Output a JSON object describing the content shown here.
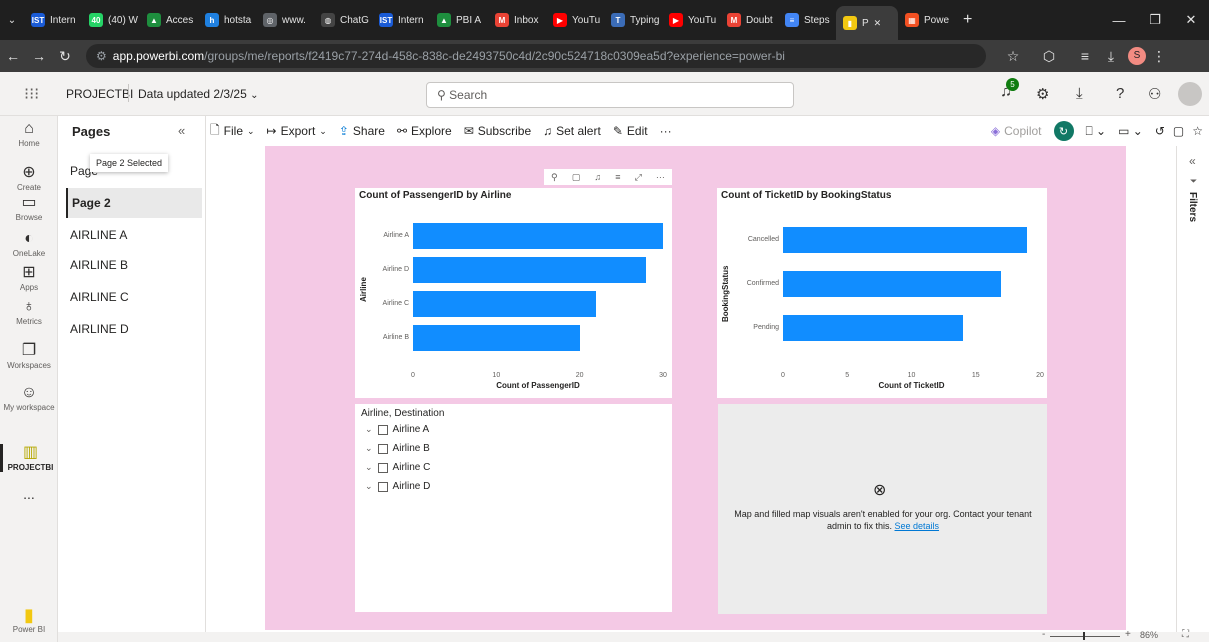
{
  "browser": {
    "tabs": [
      {
        "label": "Intern",
        "fav": "IST",
        "color": "#1a5bd6"
      },
      {
        "label": "(40) W",
        "fav": "40",
        "color": "#25d366"
      },
      {
        "label": "Acces",
        "fav": "▲",
        "color": "#1e8e3e"
      },
      {
        "label": "hotsta",
        "fav": "h",
        "color": "#1f80e0"
      },
      {
        "label": "www.",
        "fav": "◎",
        "color": "#5f6368"
      },
      {
        "label": "ChatG",
        "fav": "◍",
        "color": "#444"
      },
      {
        "label": "Intern",
        "fav": "IST",
        "color": "#1a5bd6"
      },
      {
        "label": "PBI A",
        "fav": "▲",
        "color": "#1e8e3e"
      },
      {
        "label": "Inbox",
        "fav": "M",
        "color": "#ea4335"
      },
      {
        "label": "YouTu",
        "fav": "▶",
        "color": "#ff0000"
      },
      {
        "label": "Typing",
        "fav": "T",
        "color": "#3b6cb7"
      },
      {
        "label": "YouTu",
        "fav": "▶",
        "color": "#ff0000"
      },
      {
        "label": "Doubt",
        "fav": "M",
        "color": "#ea4335"
      },
      {
        "label": "Steps",
        "fav": "≡",
        "color": "#4285f4"
      },
      {
        "label": "P",
        "fav": "▮",
        "color": "#f2c811"
      },
      {
        "label": "Powe",
        "fav": "▦",
        "color": "#f25022"
      }
    ],
    "new_tab": "+",
    "url_host": "app.powerbi.com",
    "url_path": "/groups/me/reports/f2419c77-274d-458c-838c-de2493750c4d/2c90c524718c0309ea5d?experience=power-bi",
    "profile_initial": "S"
  },
  "header": {
    "workspace": "PROJECTBI",
    "data_updated": "Data updated 2/3/25",
    "search_placeholder": "Search",
    "notif_count": "5"
  },
  "rail": [
    {
      "label": "Home",
      "icon": "⌂"
    },
    {
      "label": "Create",
      "icon": "⊕"
    },
    {
      "label": "Browse",
      "icon": "▭"
    },
    {
      "label": "OneLake",
      "icon": "◐"
    },
    {
      "label": "Apps",
      "icon": "⊞"
    },
    {
      "label": "Metrics",
      "icon": "♁"
    },
    {
      "label": "Workspaces",
      "icon": "❐"
    },
    {
      "label": "My workspace",
      "icon": "☺"
    },
    {
      "label": "PROJECTBI",
      "icon": "▥"
    },
    {
      "label": "...",
      "icon": ""
    }
  ],
  "rail_brand": "Power BI",
  "pages_pane": {
    "title": "Pages",
    "collapse": "«",
    "tooltip": "Page 2 Selected",
    "items": [
      "Page",
      "Page 2",
      "AIRLINE A",
      "AIRLINE B",
      "AIRLINE C",
      "AIRLINE D"
    ]
  },
  "toolbar": {
    "file": "File",
    "export": "Export",
    "share": "Share",
    "explore": "Explore",
    "subscribe": "Subscribe",
    "set_alert": "Set alert",
    "edit": "Edit",
    "more": "···",
    "copilot": "Copilot"
  },
  "filters_label": "Filters",
  "charts": [
    {
      "type": "bar",
      "title": "Count of PassengerID by Airline",
      "categories": [
        "Airline A",
        "Airline D",
        "Airline C",
        "Airline B"
      ],
      "values": [
        30,
        28,
        22,
        20
      ],
      "xlabel": "Count of PassengerID",
      "ylabel": "Airline",
      "xlim": [
        0,
        30
      ],
      "ticks": [
        0,
        10,
        20,
        30
      ]
    },
    {
      "type": "bar",
      "title": "Count of TicketID by BookingStatus",
      "categories": [
        "Cancelled",
        "Confirmed",
        "Pending"
      ],
      "values": [
        19,
        17,
        14
      ],
      "xlabel": "Count of TicketID",
      "ylabel": "BookingStatus",
      "xlim": [
        0,
        20
      ],
      "ticks": [
        0,
        5,
        10,
        15,
        20
      ]
    }
  ],
  "slicer": {
    "title": "Airline, Destination",
    "items": [
      "Airline A",
      "Airline B",
      "Airline C",
      "Airline D"
    ]
  },
  "map_error": {
    "message": "Map and filled map visuals aren't enabled for your org. Contact your tenant admin to fix this.",
    "link": "See details"
  },
  "zoom": {
    "minus": "-",
    "plus": "+",
    "value": "86%"
  }
}
